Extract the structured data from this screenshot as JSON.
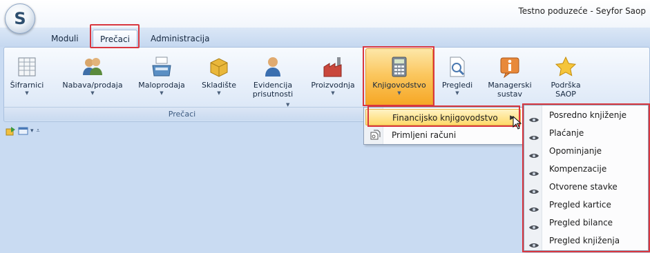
{
  "window": {
    "title": "Testno poduzeće - Seyfor Saop"
  },
  "app_button": {
    "letter": "S"
  },
  "tabs": [
    {
      "label": "Moduli"
    },
    {
      "label": "Prečaci",
      "selected": true
    },
    {
      "label": "Administracija"
    }
  ],
  "ribbon": {
    "group_label": "Prečaci",
    "buttons": [
      {
        "label": "Šifrarnici",
        "icon": "grid-table-icon",
        "dropdown": true
      },
      {
        "label": "Nabava/prodaja",
        "icon": "people-icon",
        "dropdown": true
      },
      {
        "label": "Maloprodaja",
        "icon": "cash-register-icon",
        "dropdown": true
      },
      {
        "label": "Skladište",
        "icon": "boxes-icon",
        "dropdown": true
      },
      {
        "label": "Evidencija prisutnosti",
        "label_line1": "Evidencija",
        "label_line2": "prisutnosti",
        "icon": "person-icon",
        "dropdown": true
      },
      {
        "label": "Proizvodnja",
        "icon": "factory-icon",
        "dropdown": true
      },
      {
        "label": "Knjigovodstvo",
        "icon": "calculator-icon",
        "dropdown": true,
        "active": true
      },
      {
        "label": "Pregledi",
        "icon": "document-search-icon",
        "dropdown": true
      },
      {
        "label": "Managerski sustav",
        "label_line1": "Managerski",
        "label_line2": "sustav",
        "icon": "info-icon",
        "dropdown": true
      },
      {
        "label": "Podrška SAOP",
        "label_line1": "Podrška",
        "label_line2": "SAOP",
        "icon": "star-icon",
        "dropdown": false
      }
    ]
  },
  "quick_access": {
    "items": [
      "export-icon",
      "window-icon",
      "dropdown-icon",
      "customize-icon"
    ]
  },
  "knjigovodstvo_menu": {
    "items": [
      {
        "label": "Financijsko knjigovodstvo",
        "has_submenu": true,
        "highlighted": true
      },
      {
        "label": "Primljeni računi",
        "icon": "receipts-icon"
      }
    ]
  },
  "financijsko_submenu": {
    "items": [
      {
        "label": "Posredno knjiženje",
        "icon": "eye-icon"
      },
      {
        "label": "Plaćanje",
        "icon": "eye-icon"
      },
      {
        "label": "Opominjanje",
        "icon": "eye-icon"
      },
      {
        "label": "Kompenzacije",
        "icon": "eye-icon"
      },
      {
        "label": "Otvorene stavke",
        "icon": "eye-icon"
      },
      {
        "label": "Pregled kartice",
        "icon": "eye-icon"
      },
      {
        "label": "Pregled bilance",
        "icon": "eye-icon"
      },
      {
        "label": "Pregled knjiženja",
        "icon": "eye-icon"
      }
    ]
  },
  "colors": {
    "ribbon_bg": "#e4edf9",
    "app_bg": "#c9dbf2",
    "active_orange": "#f6a624",
    "highlight_red": "#d9363e"
  }
}
